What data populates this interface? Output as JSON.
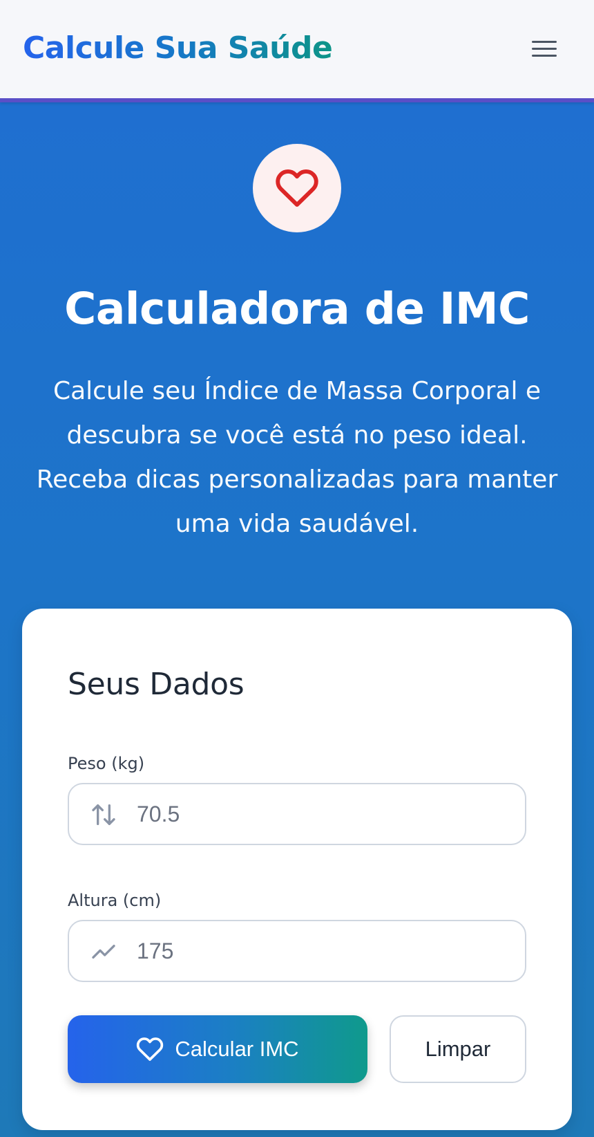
{
  "header": {
    "brand": "Calcule Sua Saúde",
    "menu_icon": "hamburger-menu-icon"
  },
  "hero": {
    "icon": "heart-icon",
    "title": "Calculadora de IMC",
    "description": "Calcule seu Índice de Massa Corporal e descubra se você está no peso ideal. Receba dicas personalizadas para manter uma vida saudável."
  },
  "form": {
    "title": "Seus Dados",
    "weight": {
      "label": "Peso (kg)",
      "placeholder": "70.5",
      "icon": "arrows-up-down-icon"
    },
    "height": {
      "label": "Altura (cm)",
      "placeholder": "175",
      "icon": "trending-up-icon"
    },
    "calculate_label": "Calcular IMC",
    "calculate_icon": "heart-icon",
    "clear_label": "Limpar"
  },
  "colors": {
    "primary_blue": "#2563eb",
    "teal": "#0d9488",
    "hero_bg": "#1f6fd0",
    "heart_red": "#dc2626",
    "header_border": "#5a4fc7"
  }
}
